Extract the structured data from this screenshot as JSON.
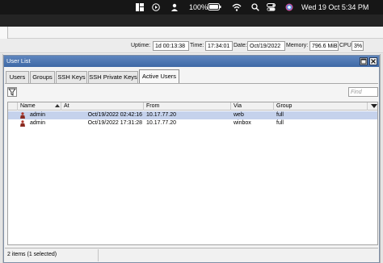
{
  "menubar": {
    "battery": "100%",
    "datetime": "Wed 19 Oct  5:34 PM"
  },
  "status": {
    "uptime_label": "Uptime:",
    "uptime_value": "1d 00:13:38",
    "time_label": "Time:",
    "time_value": "17:34:01",
    "date_label": "Date:",
    "date_value": "Oct/19/2022",
    "memory_label": "Memory:",
    "memory_value": "796.6 MiB",
    "cpu_label": "CPU:",
    "cpu_value": "3%"
  },
  "window": {
    "title": "User List",
    "tabs": [
      {
        "label": "Users"
      },
      {
        "label": "Groups"
      },
      {
        "label": "SSH Keys"
      },
      {
        "label": "SSH Private Keys"
      },
      {
        "label": "Active Users"
      }
    ],
    "find_placeholder": "Find",
    "columns": [
      "Name",
      "At",
      "From",
      "Via",
      "Group"
    ],
    "rows": [
      {
        "name": "admin",
        "at": "Oct/19/2022 02:42:16",
        "from": "10.17.77.20",
        "via": "web",
        "group": "full",
        "selected": true
      },
      {
        "name": "admin",
        "at": "Oct/19/2022 17:31:28",
        "from": "10.17.77.20",
        "via": "winbox",
        "group": "full",
        "selected": false
      }
    ],
    "status_text": "2 items (1 selected)"
  },
  "colors": {
    "title_bar": "#4a74b0",
    "selected_row": "#c5d2ec",
    "menubar": "#161616"
  },
  "icons": [
    "layout-icon",
    "play-circle-icon",
    "user-icon",
    "battery-icon",
    "wifi-icon",
    "search-icon",
    "toggles-icon",
    "colorwheel-icon",
    "filter-icon",
    "user-icon"
  ]
}
